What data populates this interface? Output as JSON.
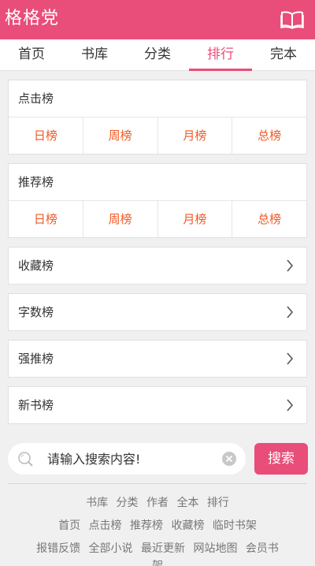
{
  "header": {
    "title": "格格党",
    "icon": "open-book-icon"
  },
  "nav": {
    "tabs": [
      "首页",
      "书库",
      "分类",
      "排行",
      "完本"
    ],
    "active": "排行"
  },
  "rank_click": {
    "title": "点击榜",
    "items": [
      "日榜",
      "周榜",
      "月榜",
      "总榜"
    ]
  },
  "rank_recommend": {
    "title": "推荐榜",
    "items": [
      "日榜",
      "周榜",
      "月榜",
      "总榜"
    ]
  },
  "links": [
    "收藏榜",
    "字数榜",
    "强推榜",
    "新书榜"
  ],
  "search": {
    "placeholder": "请输入搜索内容!",
    "button": "搜索"
  },
  "footer": {
    "row1": [
      "书库",
      "分类",
      "作者",
      "全本",
      "排行"
    ],
    "row2": [
      "首页",
      "点击榜",
      "推荐榜",
      "收藏榜",
      "临时书架"
    ],
    "row3": [
      "报错反馈",
      "全部小说",
      "最近更新",
      "网站地图",
      "会员书"
    ],
    "row4": "架"
  },
  "colors": {
    "brand": "#e94d79",
    "rank_text": "#f05a24"
  }
}
